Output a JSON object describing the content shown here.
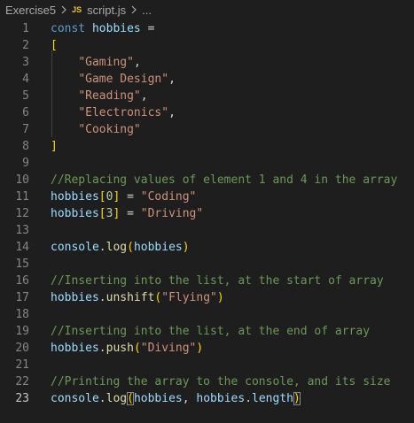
{
  "breadcrumb": {
    "folder": "Exercise5",
    "file_badge": "JS",
    "file": "script.js",
    "more": "..."
  },
  "editor": {
    "active_line": 23,
    "lines": [
      {
        "n": "1",
        "tokens": [
          {
            "t": "const",
            "c": "kw"
          },
          {
            "t": " ",
            "c": "pun"
          },
          {
            "t": "hobbies",
            "c": "var"
          },
          {
            "t": " =",
            "c": "pun"
          }
        ]
      },
      {
        "n": "2",
        "tokens": [
          {
            "t": "[",
            "c": "br1"
          }
        ]
      },
      {
        "n": "3",
        "tokens": [
          {
            "t": "    ",
            "c": "pun"
          },
          {
            "t": "\"Gaming\"",
            "c": "str"
          },
          {
            "t": ",",
            "c": "pun"
          }
        ]
      },
      {
        "n": "4",
        "tokens": [
          {
            "t": "    ",
            "c": "pun"
          },
          {
            "t": "\"Game Design\"",
            "c": "str"
          },
          {
            "t": ",",
            "c": "pun"
          }
        ]
      },
      {
        "n": "5",
        "tokens": [
          {
            "t": "    ",
            "c": "pun"
          },
          {
            "t": "\"Reading\"",
            "c": "str"
          },
          {
            "t": ",",
            "c": "pun"
          }
        ]
      },
      {
        "n": "6",
        "tokens": [
          {
            "t": "    ",
            "c": "pun"
          },
          {
            "t": "\"Electronics\"",
            "c": "str"
          },
          {
            "t": ",",
            "c": "pun"
          }
        ]
      },
      {
        "n": "7",
        "tokens": [
          {
            "t": "    ",
            "c": "pun"
          },
          {
            "t": "\"Cooking\"",
            "c": "str"
          }
        ]
      },
      {
        "n": "8",
        "tokens": [
          {
            "t": "]",
            "c": "br1"
          }
        ]
      },
      {
        "n": "9",
        "tokens": []
      },
      {
        "n": "10",
        "tokens": [
          {
            "t": "//Replacing values of element 1 and 4 in the array",
            "c": "cmt"
          }
        ]
      },
      {
        "n": "11",
        "tokens": [
          {
            "t": "hobbies",
            "c": "var"
          },
          {
            "t": "[",
            "c": "br1"
          },
          {
            "t": "0",
            "c": "num"
          },
          {
            "t": "]",
            "c": "br1"
          },
          {
            "t": " = ",
            "c": "pun"
          },
          {
            "t": "\"Coding\"",
            "c": "str"
          }
        ]
      },
      {
        "n": "12",
        "tokens": [
          {
            "t": "hobbies",
            "c": "var"
          },
          {
            "t": "[",
            "c": "br1"
          },
          {
            "t": "3",
            "c": "num"
          },
          {
            "t": "]",
            "c": "br1"
          },
          {
            "t": " = ",
            "c": "pun"
          },
          {
            "t": "\"Driving\"",
            "c": "str"
          }
        ]
      },
      {
        "n": "13",
        "tokens": []
      },
      {
        "n": "14",
        "tokens": [
          {
            "t": "console",
            "c": "var"
          },
          {
            "t": ".",
            "c": "pun"
          },
          {
            "t": "log",
            "c": "fn"
          },
          {
            "t": "(",
            "c": "br1"
          },
          {
            "t": "hobbies",
            "c": "var"
          },
          {
            "t": ")",
            "c": "br1"
          }
        ]
      },
      {
        "n": "15",
        "tokens": []
      },
      {
        "n": "16",
        "tokens": [
          {
            "t": "//Inserting into the list, at the start of array",
            "c": "cmt"
          }
        ]
      },
      {
        "n": "17",
        "tokens": [
          {
            "t": "hobbies",
            "c": "var"
          },
          {
            "t": ".",
            "c": "pun"
          },
          {
            "t": "unshift",
            "c": "fn"
          },
          {
            "t": "(",
            "c": "br1"
          },
          {
            "t": "\"Flying\"",
            "c": "str"
          },
          {
            "t": ")",
            "c": "br1"
          }
        ]
      },
      {
        "n": "18",
        "tokens": []
      },
      {
        "n": "19",
        "tokens": [
          {
            "t": "//Inserting into the list, at the end of array",
            "c": "cmt"
          }
        ]
      },
      {
        "n": "20",
        "tokens": [
          {
            "t": "hobbies",
            "c": "var"
          },
          {
            "t": ".",
            "c": "pun"
          },
          {
            "t": "push",
            "c": "fn"
          },
          {
            "t": "(",
            "c": "br1"
          },
          {
            "t": "\"Diving\"",
            "c": "str"
          },
          {
            "t": ")",
            "c": "br1"
          }
        ]
      },
      {
        "n": "21",
        "tokens": []
      },
      {
        "n": "22",
        "tokens": [
          {
            "t": "//Printing the array to the console, and its size",
            "c": "cmt"
          }
        ]
      },
      {
        "n": "23",
        "tokens": [
          {
            "t": "console",
            "c": "var"
          },
          {
            "t": ".",
            "c": "pun"
          },
          {
            "t": "log",
            "c": "fn"
          },
          {
            "t": "(",
            "c": "br1 brmatch"
          },
          {
            "t": "hobbies",
            "c": "var"
          },
          {
            "t": ", ",
            "c": "pun"
          },
          {
            "t": "hobbies",
            "c": "var"
          },
          {
            "t": ".",
            "c": "pun"
          },
          {
            "t": "length",
            "c": "var"
          },
          {
            "t": ")",
            "c": "br1 brmatch"
          }
        ]
      }
    ]
  },
  "colors": {
    "background": "#1e1e1e",
    "keyword": "#569cd6",
    "variable": "#9cdcfe",
    "string": "#ce9178",
    "number": "#b5cea8",
    "function": "#dcdcaa",
    "comment": "#6a9955",
    "bracket": "#ffd700"
  },
  "icons": {
    "breadcrumb_separator": "chevron-right-icon"
  }
}
